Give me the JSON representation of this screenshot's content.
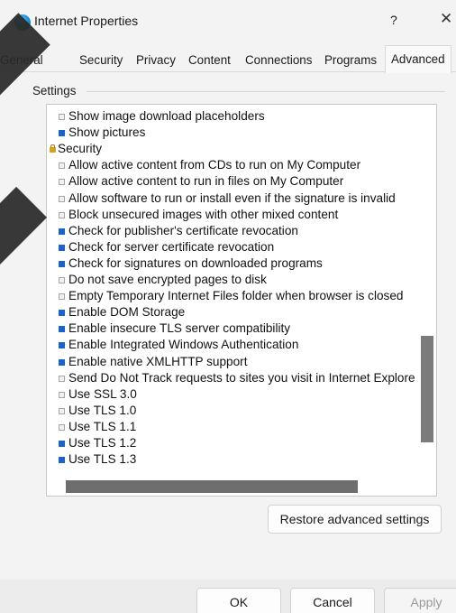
{
  "window": {
    "title": "Internet Properties",
    "help_glyph": "?",
    "close_glyph": "✕"
  },
  "tabs": [
    {
      "label": "General"
    },
    {
      "label": "Security"
    },
    {
      "label": "Privacy"
    },
    {
      "label": "Content"
    },
    {
      "label": "Connections"
    },
    {
      "label": "Programs"
    },
    {
      "label": "Advanced",
      "active": true
    }
  ],
  "settings": {
    "group_label": "Settings",
    "items": [
      {
        "label": "Show image download placeholders",
        "type": "checkbox",
        "checked": false
      },
      {
        "label": "Show pictures",
        "type": "checkbox",
        "checked": true
      },
      {
        "label": "Security",
        "type": "group"
      },
      {
        "label": "Allow active content from CDs to run on My Computer",
        "type": "checkbox",
        "checked": false
      },
      {
        "label": "Allow active content to run in files on My Computer",
        "type": "checkbox",
        "checked": false
      },
      {
        "label": "Allow software to run or install even if the signature is invalid",
        "type": "checkbox",
        "checked": false
      },
      {
        "label": "Block unsecured images with other mixed content",
        "type": "checkbox",
        "checked": false
      },
      {
        "label": "Check for publisher's certificate revocation",
        "type": "checkbox",
        "checked": true
      },
      {
        "label": "Check for server certificate revocation",
        "type": "checkbox",
        "checked": true
      },
      {
        "label": "Check for signatures on downloaded programs",
        "type": "checkbox",
        "checked": true
      },
      {
        "label": "Do not save encrypted pages to disk",
        "type": "checkbox",
        "checked": false
      },
      {
        "label": "Empty Temporary Internet Files folder when browser is closed",
        "type": "checkbox",
        "checked": false
      },
      {
        "label": "Enable DOM Storage",
        "type": "checkbox",
        "checked": true
      },
      {
        "label": "Enable insecure TLS server compatibility",
        "type": "checkbox",
        "checked": true
      },
      {
        "label": "Enable Integrated Windows Authentication",
        "type": "checkbox",
        "checked": true
      },
      {
        "label": "Enable native XMLHTTP support",
        "type": "checkbox",
        "checked": true
      },
      {
        "label": "Send Do Not Track requests to sites you visit in Internet Explore",
        "type": "checkbox",
        "checked": false
      },
      {
        "label": "Use SSL 3.0",
        "type": "checkbox",
        "checked": false
      },
      {
        "label": "Use TLS 1.0",
        "type": "checkbox",
        "checked": false
      },
      {
        "label": "Use TLS 1.1",
        "type": "checkbox",
        "checked": false
      },
      {
        "label": "Use TLS 1.2",
        "type": "checkbox",
        "checked": true
      },
      {
        "label": "Use TLS 1.3",
        "type": "checkbox",
        "checked": true
      }
    ]
  },
  "buttons": {
    "restore": "Restore advanced settings",
    "ok": "OK",
    "cancel": "Cancel",
    "apply": "Apply"
  },
  "colors": {
    "checked": "#1a63c9",
    "dialog_bg": "#f3f3f3",
    "list_bg": "#ffffff"
  }
}
